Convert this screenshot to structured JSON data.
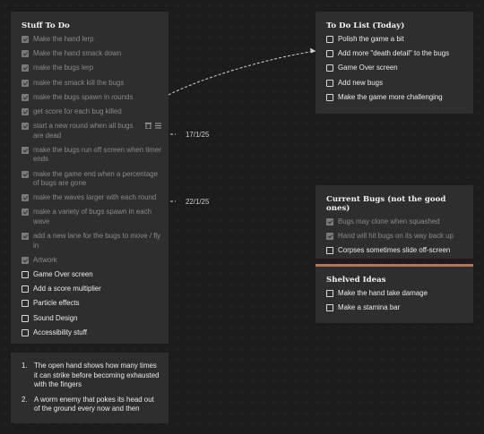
{
  "stuff_to_do": {
    "title": "Stuff To Do",
    "items": [
      {
        "label": "Make the hand lerp",
        "checked": true
      },
      {
        "label": "Make the hand smack down",
        "checked": true
      },
      {
        "label": "make the bugs lerp",
        "checked": true
      },
      {
        "label": "make the smack kill the bugs",
        "checked": true
      },
      {
        "label": "make the bugs spawn in rounds",
        "checked": true
      },
      {
        "label": "get score for each bug killed",
        "checked": true
      },
      {
        "label": "start a new round when all bugs are dead",
        "checked": true
      },
      {
        "label": "make the bugs run off screen when timer ends",
        "checked": true
      },
      {
        "label": "make the game end when a percentage of bugs are gone",
        "checked": true
      },
      {
        "label": "make the waves larger with each round",
        "checked": true
      },
      {
        "label": "make a variety of bugs spawn in each wave",
        "checked": true
      },
      {
        "label": "add a new lane for the bugs to move / fly in",
        "checked": true
      },
      {
        "label": "Artwork",
        "checked": true
      },
      {
        "label": "Game Over screen",
        "checked": false
      },
      {
        "label": "Add a score multiplier",
        "checked": false
      },
      {
        "label": "Particle effects",
        "checked": false
      },
      {
        "label": "Sound Design",
        "checked": false
      },
      {
        "label": "Accessibility stuff",
        "checked": false
      }
    ]
  },
  "todo_today": {
    "title": "To Do List (Today)",
    "items": [
      {
        "label": "Polish the game a bit",
        "checked": false
      },
      {
        "label": "Add more \"death detail\" to the bugs",
        "checked": false
      },
      {
        "label": "Game Over screen",
        "checked": false
      },
      {
        "label": "Add new bugs",
        "checked": false
      },
      {
        "label": "Make the game more challenging",
        "checked": false
      }
    ]
  },
  "current_bugs": {
    "title": "Current Bugs (not the good ones)",
    "items": [
      {
        "label": "Bugs may clone when squashed",
        "checked": true
      },
      {
        "label": "Hand will hit bugs on its way back up",
        "checked": true
      },
      {
        "label": "Corpses sometimes slide off-screen",
        "checked": false
      }
    ]
  },
  "shelved_ideas": {
    "title": "Shelved Ideas",
    "accent_color": "#e25c5c",
    "items": [
      {
        "label": "Make the hand take damage",
        "checked": false
      },
      {
        "label": "Make a stamina bar",
        "checked": false
      }
    ]
  },
  "ideas_list": {
    "items": [
      {
        "number": "1.",
        "text": "The open hand shows how many times it can strike before becoming exhausted with the fingers"
      },
      {
        "number": "2.",
        "text": "A worm enemy that pokes its head out of the ground every now and then"
      }
    ]
  },
  "dates": {
    "first": "17/1/25",
    "second": "22/1/25"
  },
  "row_tools": {
    "delete_icon": "trash-icon",
    "menu_icon": "menu-icon"
  }
}
